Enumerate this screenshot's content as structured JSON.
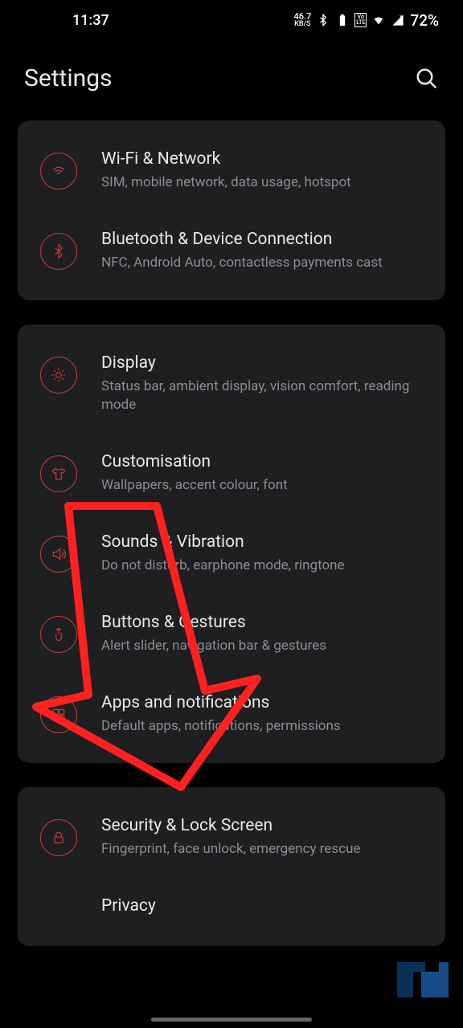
{
  "status": {
    "time": "11:37",
    "speed": "46.7",
    "speed_unit": "KB/S",
    "lte": "Vo LTE",
    "battery": "72%"
  },
  "header": {
    "title": "Settings"
  },
  "groups": [
    {
      "items": [
        {
          "icon": "wifi",
          "title": "Wi-Fi & Network",
          "sub": "SIM, mobile network, data usage, hotspot"
        },
        {
          "icon": "bluetooth",
          "title": "Bluetooth & Device Connection",
          "sub": "NFC, Android Auto, contactless payments cast"
        }
      ]
    },
    {
      "items": [
        {
          "icon": "display",
          "title": "Display",
          "sub": "Status bar, ambient display, vision comfort, reading mode"
        },
        {
          "icon": "shirt",
          "title": "Customisation",
          "sub": "Wallpapers, accent colour, font"
        },
        {
          "icon": "sound",
          "title": "Sounds & Vibration",
          "sub": "Do not disturb, earphone mode, ringtone"
        },
        {
          "icon": "gesture",
          "title": "Buttons & Gestures",
          "sub": "Alert slider, navigation bar & gestures"
        },
        {
          "icon": "grid",
          "title": "Apps and notifications",
          "sub": "Default apps, notifications, permissions"
        }
      ]
    },
    {
      "items": [
        {
          "icon": "lock",
          "title": "Security & Lock Screen",
          "sub": "Fingerprint, face unlock, emergency rescue"
        },
        {
          "icon": "privacy",
          "title": "Privacy",
          "sub": ""
        }
      ]
    }
  ]
}
